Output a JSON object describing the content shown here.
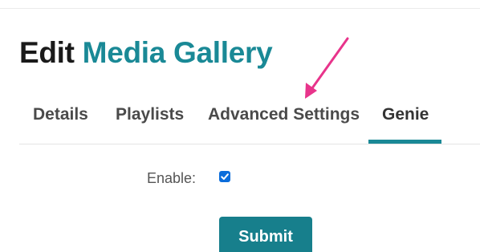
{
  "header": {
    "title_prefix": "Edit",
    "title_name": "Media Gallery"
  },
  "tabs": [
    {
      "label": "Details",
      "active": false
    },
    {
      "label": "Playlists",
      "active": false
    },
    {
      "label": "Advanced Settings",
      "active": false
    },
    {
      "label": "Genie",
      "active": true
    }
  ],
  "form": {
    "enable_label": "Enable:",
    "enable_checked": true,
    "submit_label": "Submit"
  },
  "colors": {
    "brand_teal": "#1a8996",
    "button_teal": "#177f8c",
    "checkbox_blue": "#0b6ddb",
    "annotation_arrow": "#e8348b"
  },
  "annotation": {
    "icon": "pointer-arrow",
    "points_to": "Advanced Settings tab"
  }
}
